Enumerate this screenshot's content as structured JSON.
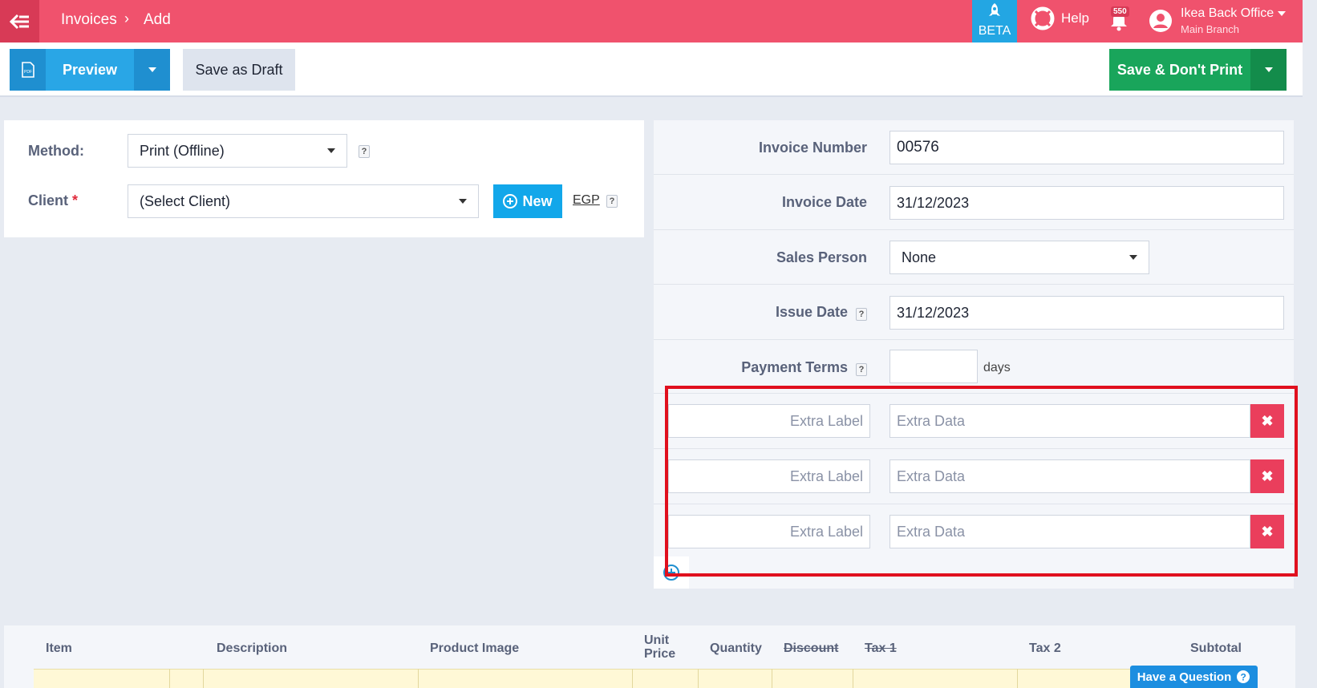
{
  "topbar": {
    "breadcrumb": [
      "Invoices",
      "Add"
    ],
    "breadcrumb_sep": "›",
    "beta_label": "BETA",
    "help_label": "Help",
    "notifications_count": "550",
    "user_name": "Ikea Back Office",
    "user_branch": "Main Branch"
  },
  "actions": {
    "preview_label": "Preview",
    "draft_label": "Save as Draft",
    "save_label": "Save & Don't Print"
  },
  "left": {
    "method_label": "Method:",
    "method_value": "Print (Offline)",
    "client_label": "Client",
    "client_required": "*",
    "client_value": "(Select Client)",
    "new_label": "New",
    "currency": "EGP",
    "help_mark": "?"
  },
  "right": {
    "invoice_number_label": "Invoice Number",
    "invoice_number": "00576",
    "invoice_date_label": "Invoice Date",
    "invoice_date": "31/12/2023",
    "sales_person_label": "Sales Person",
    "sales_person": "None",
    "issue_date_label": "Issue Date",
    "issue_date": "31/12/2023",
    "payment_terms_label": "Payment Terms",
    "payment_terms_value": "",
    "payment_terms_unit": "days",
    "extra_rows": [
      {
        "label_placeholder": "Extra Label",
        "data_placeholder": "Extra Data"
      },
      {
        "label_placeholder": "Extra Label",
        "data_placeholder": "Extra Data"
      },
      {
        "label_placeholder": "Extra Label",
        "data_placeholder": "Extra Data"
      }
    ],
    "delete_glyph": "✖"
  },
  "items_table": {
    "columns": [
      "Item",
      "Description",
      "Product Image",
      "Unit Price",
      "Quantity",
      "Discount",
      "Tax 1",
      "Tax 2",
      "Subtotal"
    ]
  },
  "question_label": "Have a Question",
  "colors": {
    "topbar": "#f0526d",
    "beta": "#23a6e3",
    "preview": "#29a6e6",
    "save": "#19a55b",
    "delete": "#ea3e5c",
    "highlight": "#e0101e"
  }
}
